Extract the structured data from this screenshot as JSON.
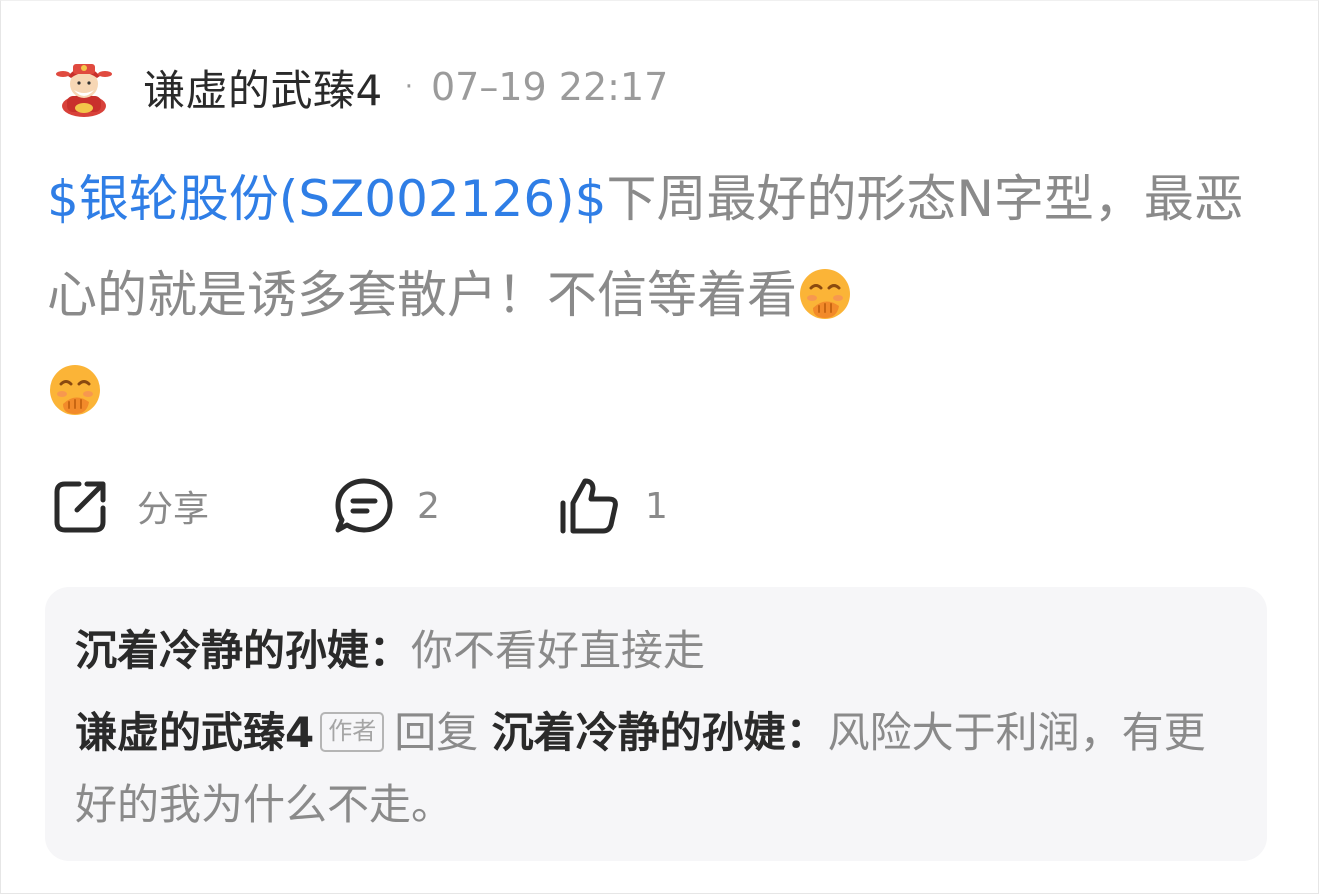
{
  "post": {
    "author": "谦虚的武臻4",
    "separator": "·",
    "timestamp": "07–19 22:17",
    "stock_link": "$银轮股份(SZ002126)$",
    "text": "下周最好的形态N字型，最恶心的就是诱多套散户！不信等着看",
    "emoji_icon": "hand-over-mouth-emoji-icon"
  },
  "actions": {
    "share_label": "分享",
    "comment_count": "2",
    "like_count": "1"
  },
  "replies": [
    {
      "name": "沉着冷静的孙婕",
      "colon": "：",
      "text": "你不看好直接走"
    },
    {
      "name": "谦虚的武臻4",
      "tag": "作者",
      "reply_word": "回复",
      "reply_to": "沉着冷静的孙婕",
      "colon": "：",
      "text": "风险大于利润，有更好的我为什么不走。"
    }
  ],
  "colors": {
    "link": "#2f7ee6",
    "text_muted": "#8a8a8a",
    "reply_bg": "#f6f6f8"
  }
}
